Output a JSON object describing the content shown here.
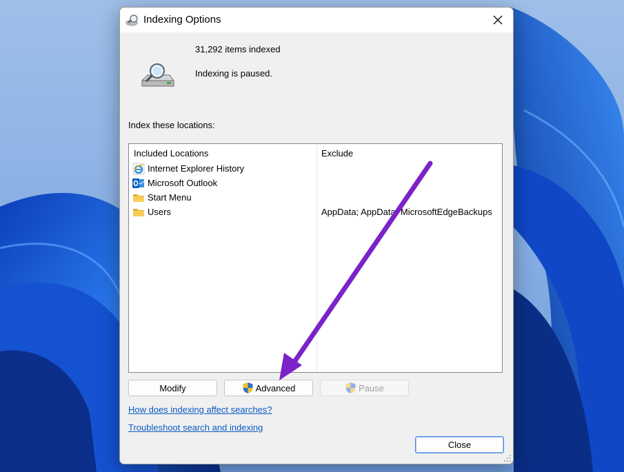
{
  "window": {
    "title": "Indexing Options",
    "close_glyph": "✕"
  },
  "status": {
    "items_indexed": "31,292 items indexed",
    "state": "Indexing is paused."
  },
  "locations": {
    "section_label": "Index these locations:",
    "columns": {
      "included": "Included Locations",
      "exclude": "Exclude"
    },
    "rows": [
      {
        "name": "Internet Explorer History",
        "exclude": "",
        "icon": "internet-explorer-icon"
      },
      {
        "name": "Microsoft Outlook",
        "exclude": "",
        "icon": "outlook-icon"
      },
      {
        "name": "Start Menu",
        "exclude": "",
        "icon": "folder-icon"
      },
      {
        "name": "Users",
        "exclude": "AppData; AppData; MicrosoftEdgeBackups",
        "icon": "folder-icon"
      }
    ]
  },
  "buttons": {
    "modify": "Modify",
    "advanced": "Advanced",
    "pause": "Pause",
    "close": "Close"
  },
  "links": {
    "how_indexing": "How does indexing affect searches?",
    "troubleshoot": "Troubleshoot search and indexing"
  },
  "colors": {
    "link": "#0a5bc4",
    "annotation_arrow": "#7b22c9",
    "wallpaper_blue": "#1c5fd9"
  }
}
